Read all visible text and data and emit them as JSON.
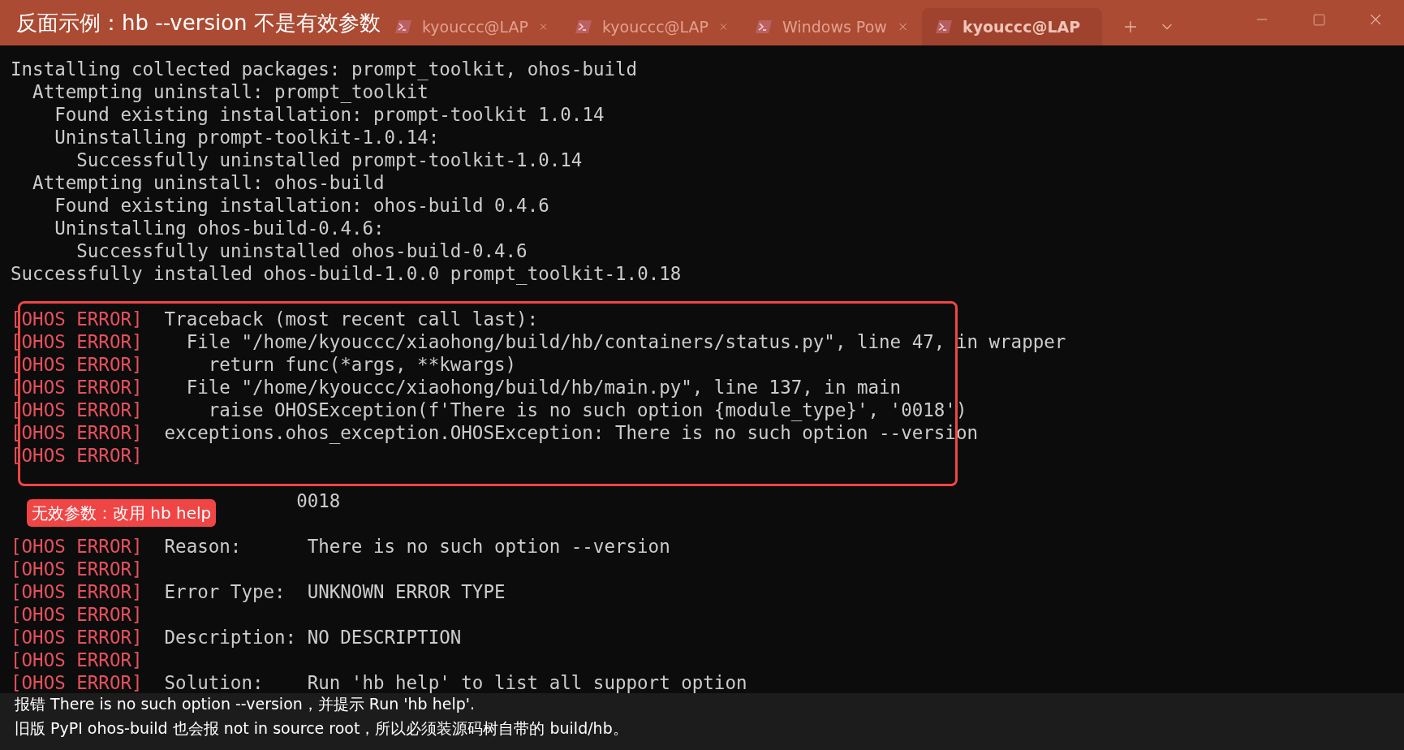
{
  "title_banner": "反面示例：hb --version 不是有效参数",
  "tabs": [
    {
      "label": "kyouccc@LAP",
      "selected": false
    },
    {
      "label": "kyouccc@LAP",
      "selected": false
    },
    {
      "label": "Windows Pow",
      "selected": false
    },
    {
      "label": "kyouccc@LAP",
      "selected": true
    }
  ],
  "terminal": {
    "blocks": [
      {
        "kind": "plain",
        "lines": [
          {
            "kind": "plain",
            "text": "Installing collected packages: prompt_toolkit, ohos-build"
          },
          {
            "kind": "plain",
            "text": "  Attempting uninstall: prompt_toolkit"
          },
          {
            "kind": "plain",
            "text": "    Found existing installation: prompt-toolkit 1.0.14"
          },
          {
            "kind": "plain",
            "text": "    Uninstalling prompt-toolkit-1.0.14:"
          },
          {
            "kind": "plain",
            "text": "      Successfully uninstalled prompt-toolkit-1.0.14"
          },
          {
            "kind": "plain",
            "text": "  Attempting uninstall: ohos-build"
          },
          {
            "kind": "plain",
            "text": "    Found existing installation: ohos-build 0.4.6"
          },
          {
            "kind": "plain",
            "text": "    Uninstalling ohos-build-0.4.6:"
          },
          {
            "kind": "plain",
            "text": "      Successfully uninstalled ohos-build-0.4.6"
          },
          {
            "kind": "plain",
            "text": "Successfully installed ohos-build-1.0.0 prompt_toolkit-1.0.18"
          },
          {
            "kind": "blank"
          }
        ]
      },
      {
        "kind": "highlight",
        "lines": [
          {
            "kind": "error",
            "prefix": "[OHOS ERROR]",
            "text": "Traceback (most recent call last):"
          },
          {
            "kind": "error",
            "prefix": "[OHOS ERROR]",
            "text": "  File \"/home/kyouccc/xiaohong/build/hb/containers/status.py\", line 47, in wrapper"
          },
          {
            "kind": "error",
            "prefix": "[OHOS ERROR]",
            "text": "    return func(*args, **kwargs)"
          },
          {
            "kind": "error",
            "prefix": "[OHOS ERROR]",
            "text": "  File \"/home/kyouccc/xiaohong/build/hb/main.py\", line 137, in main"
          },
          {
            "kind": "error",
            "prefix": "[OHOS ERROR]",
            "text": "    raise OHOSException(f'There is no such option {module_type}', '0018')"
          },
          {
            "kind": "error",
            "prefix": "[OHOS ERROR]",
            "text": "exceptions.ohos_exception.OHOSException: There is no such option --version"
          },
          {
            "kind": "error",
            "prefix": "[OHOS ERROR]"
          }
        ]
      },
      {
        "kind": "plain",
        "lines": [
          {
            "kind": "value",
            "text": "0018",
            "callout": "无效参数：改用 hb help"
          },
          {
            "kind": "blank"
          },
          {
            "kind": "error",
            "prefix": "[OHOS ERROR]",
            "text": "Reason:      There is no such option --version"
          },
          {
            "kind": "error",
            "prefix": "[OHOS ERROR]"
          },
          {
            "kind": "error",
            "prefix": "[OHOS ERROR]",
            "text": "Error Type:  UNKNOWN ERROR TYPE"
          },
          {
            "kind": "error",
            "prefix": "[OHOS ERROR]"
          },
          {
            "kind": "error",
            "prefix": "[OHOS ERROR]",
            "text": "Description: NO DESCRIPTION"
          },
          {
            "kind": "error",
            "prefix": "[OHOS ERROR]"
          },
          {
            "kind": "error",
            "prefix": "[OHOS ERROR]",
            "text": "Solution:    Run 'hb help' to list all support option"
          }
        ]
      }
    ]
  },
  "caption": [
    "报错 There is no such option --version，并提示 Run 'hb help'.",
    "旧版 PyPI ohos-build 也会报 not in source root，所以必须装源码树自带的 build/hb。"
  ]
}
